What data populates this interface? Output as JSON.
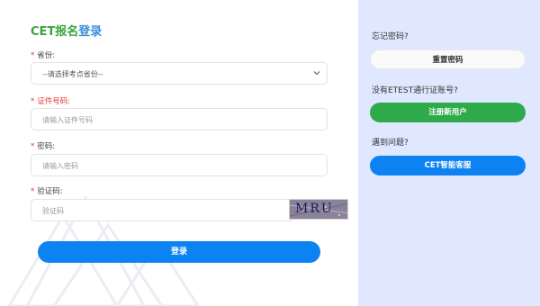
{
  "header": {
    "title_part1": "CET报名",
    "title_part2": "登录"
  },
  "form": {
    "province": {
      "label": "省份:",
      "selected": "--请选择考点省份--"
    },
    "id_number": {
      "label": "证件号码:",
      "placeholder": "请输入证件号码"
    },
    "password": {
      "label": "密码:",
      "placeholder": "请输入密码"
    },
    "captcha": {
      "label": "验证码:",
      "placeholder": "验证码",
      "image_text": "MRU"
    },
    "required_mark": "*",
    "login_label": "登录"
  },
  "side": {
    "forgot_text": "忘记密码?",
    "reset_label": "重置密码",
    "no_account_text": "没有ETEST通行证账号?",
    "register_label": "注册新用户",
    "problem_text": "遇到问题?",
    "support_label": "CET智能客服"
  },
  "colors": {
    "brand_green": "#3aa43a",
    "brand_blue": "#3b8fd9",
    "primary_button": "#0d82f2",
    "register_button": "#2eaa4a",
    "side_panel": "#dfe8ff",
    "required": "#e53935"
  },
  "icons": {
    "select_arrow": "chevron-down-icon"
  }
}
